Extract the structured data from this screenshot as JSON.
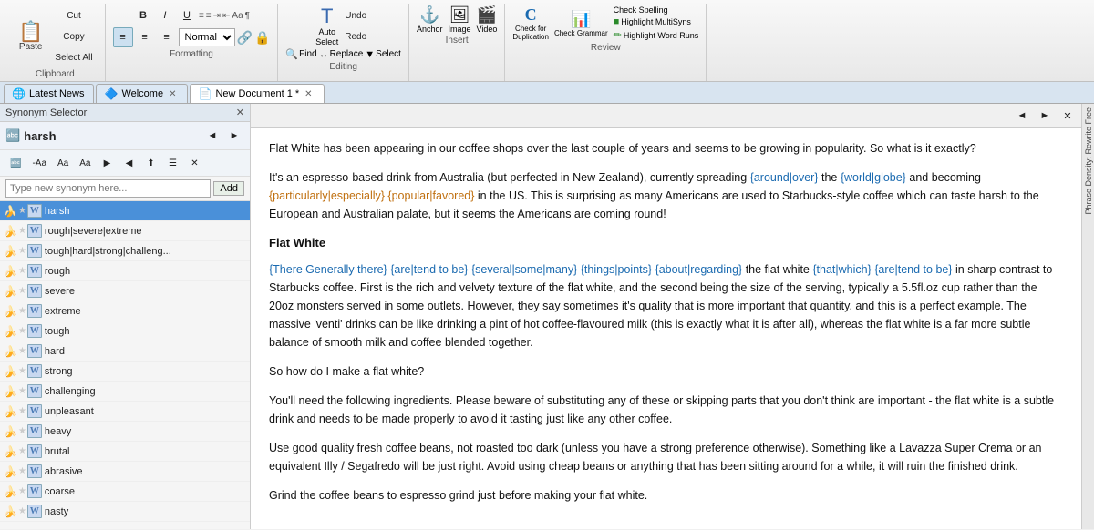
{
  "toolbar": {
    "groups": {
      "clipboard": {
        "label": "Clipboard",
        "paste": "Paste",
        "cut": "Cut",
        "copy": "Copy",
        "selectAll": "Select All"
      },
      "formatting": {
        "label": "Formatting",
        "bold": "B",
        "italic": "I",
        "underline": "U",
        "align_left": "≡",
        "align_center": "≡",
        "align_right": "≡",
        "format_select": "Normal"
      },
      "editing": {
        "label": "Editing",
        "autoSelect": "Auto Select",
        "undo": "Undo",
        "redo": "Redo",
        "find": "Find",
        "replace": "Replace",
        "select": "Select"
      },
      "insert": {
        "label": "Insert",
        "anchor": "Anchor",
        "image": "Image",
        "video": "Video"
      },
      "review": {
        "label": "Review",
        "checkDuplication": "Check for Duplication",
        "checkGrammar": "Check Grammar",
        "checkSpelling": "Check Spelling",
        "highlightMultiSyns": "Highlight MultiSyns",
        "highlightWordRuns": "Highlight Word Runs"
      }
    }
  },
  "tabs": [
    {
      "id": "latest-news",
      "label": "Latest News",
      "icon": "🌐",
      "active": false,
      "closeable": false
    },
    {
      "id": "welcome",
      "label": "Welcome",
      "icon": "🔷",
      "active": false,
      "closeable": true
    },
    {
      "id": "new-document",
      "label": "New Document 1 *",
      "icon": "📄",
      "active": true,
      "closeable": true
    }
  ],
  "synonym_panel": {
    "title": "Synonym Selector",
    "word": "harsh",
    "search_placeholder": "Type new synonym here...",
    "add_button": "Add",
    "items": [
      {
        "id": 1,
        "text": "harsh",
        "highlighted": true,
        "banana": true,
        "star": false,
        "doc": true
      },
      {
        "id": 2,
        "text": "rough|severe|extreme",
        "highlighted": false,
        "banana": true,
        "star": false,
        "doc": true
      },
      {
        "id": 3,
        "text": "tough|hard|strong|challeng...",
        "highlighted": false,
        "banana": true,
        "star": false,
        "doc": true
      },
      {
        "id": 4,
        "text": "rough",
        "highlighted": false,
        "banana": true,
        "star": false,
        "doc": true
      },
      {
        "id": 5,
        "text": "severe",
        "highlighted": false,
        "banana": true,
        "star": false,
        "doc": true
      },
      {
        "id": 6,
        "text": "extreme",
        "highlighted": false,
        "banana": true,
        "star": false,
        "doc": true
      },
      {
        "id": 7,
        "text": "tough",
        "highlighted": false,
        "banana": true,
        "star": false,
        "doc": true
      },
      {
        "id": 8,
        "text": "hard",
        "highlighted": false,
        "banana": true,
        "star": false,
        "doc": true
      },
      {
        "id": 9,
        "text": "strong",
        "highlighted": false,
        "banana": true,
        "star": false,
        "doc": true
      },
      {
        "id": 10,
        "text": "challenging",
        "highlighted": false,
        "banana": true,
        "star": false,
        "doc": true
      },
      {
        "id": 11,
        "text": "unpleasant",
        "highlighted": false,
        "banana": true,
        "star": false,
        "doc": true
      },
      {
        "id": 12,
        "text": "heavy",
        "highlighted": false,
        "banana": true,
        "star": false,
        "doc": true
      },
      {
        "id": 13,
        "text": "brutal",
        "highlighted": false,
        "banana": true,
        "star": false,
        "doc": true
      },
      {
        "id": 14,
        "text": "abrasive",
        "highlighted": false,
        "banana": true,
        "star": false,
        "doc": true
      },
      {
        "id": 15,
        "text": "coarse",
        "highlighted": false,
        "banana": true,
        "star": false,
        "doc": true
      },
      {
        "id": 16,
        "text": "nasty",
        "highlighted": false,
        "banana": true,
        "star": false,
        "doc": true
      }
    ]
  },
  "editor": {
    "content_paragraphs": [
      "Flat White has been appearing in our coffee shops over the last couple of years and seems to be growing in popularity. So what is it exactly?",
      "It's an espresso-based drink from Australia (but perfected in New Zealand), currently spreading {around|over} the {world|globe} and becoming {particularly|especially} {popular|favored} in the US. This is surprising as many Americans are used to Starbucks-style coffee which can taste harsh to the European and Australian palate, but it seems the Americans are coming round!",
      "Flat White",
      "{There|Generally there} {are|tend to be} {several|some|many} {things|points} {about|regarding} the flat white {that|which} {are|tend to be} in sharp contrast to Starbucks coffee. First is the rich and velvety texture of the flat white, and the second being the size of the serving, typically a 5.5fl.oz cup rather than the 20oz monsters served in some outlets. However, they say sometimes it's quality that is more important that quantity, and this is a perfect example. The massive 'venti' drinks can be like drinking a pint of hot coffee-flavoured milk (this is exactly what it is after all), whereas the flat white is a far more subtle balance of smooth milk and coffee blended together.",
      "So how do I make a flat white?",
      "You'll need the following ingredients. Please beware of substituting any of these or skipping parts that you don't think are important - the flat white is a subtle drink and needs to be made properly to avoid it tasting just like any other coffee.",
      "Use good quality fresh coffee beans, not roasted too dark (unless you have a strong preference otherwise). Something like a Lavazza Super Crema or an equivalent Illy / Segafredo will be just right. Avoid using cheap beans or anything that has been sitting around for a while, it will ruin the finished drink.",
      "Grind the coffee beans to espresso grind just before making your flat white."
    ]
  },
  "phrase_panel": {
    "label": "Phrase Density: Rewrite Free"
  },
  "nav_arrows": "◄ ►",
  "close_btn": "✕"
}
